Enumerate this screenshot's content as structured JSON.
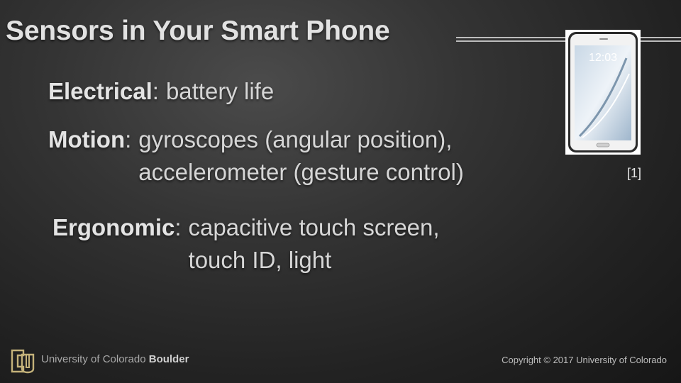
{
  "slide": {
    "title": "Sensors in Your Smart Phone",
    "bullets": [
      {
        "term": "Electrical",
        "lines": [
          "battery life"
        ]
      },
      {
        "term": "Motion",
        "lines": [
          "gyroscopes (angular position),",
          "accelerometer (gesture control)"
        ]
      },
      {
        "term": "Ergonomic",
        "lines": [
          "capacitive touch screen,",
          "touch ID, light"
        ]
      }
    ],
    "image": {
      "icon": "smartphone-image",
      "screen_time": "12:03",
      "reference": "[1]"
    }
  },
  "footer": {
    "logo_icon": "cu-logo-icon",
    "university_prefix": "University of Colorado",
    "university_campus": "Boulder",
    "copyright": "Copyright © 2017 University of Colorado"
  }
}
